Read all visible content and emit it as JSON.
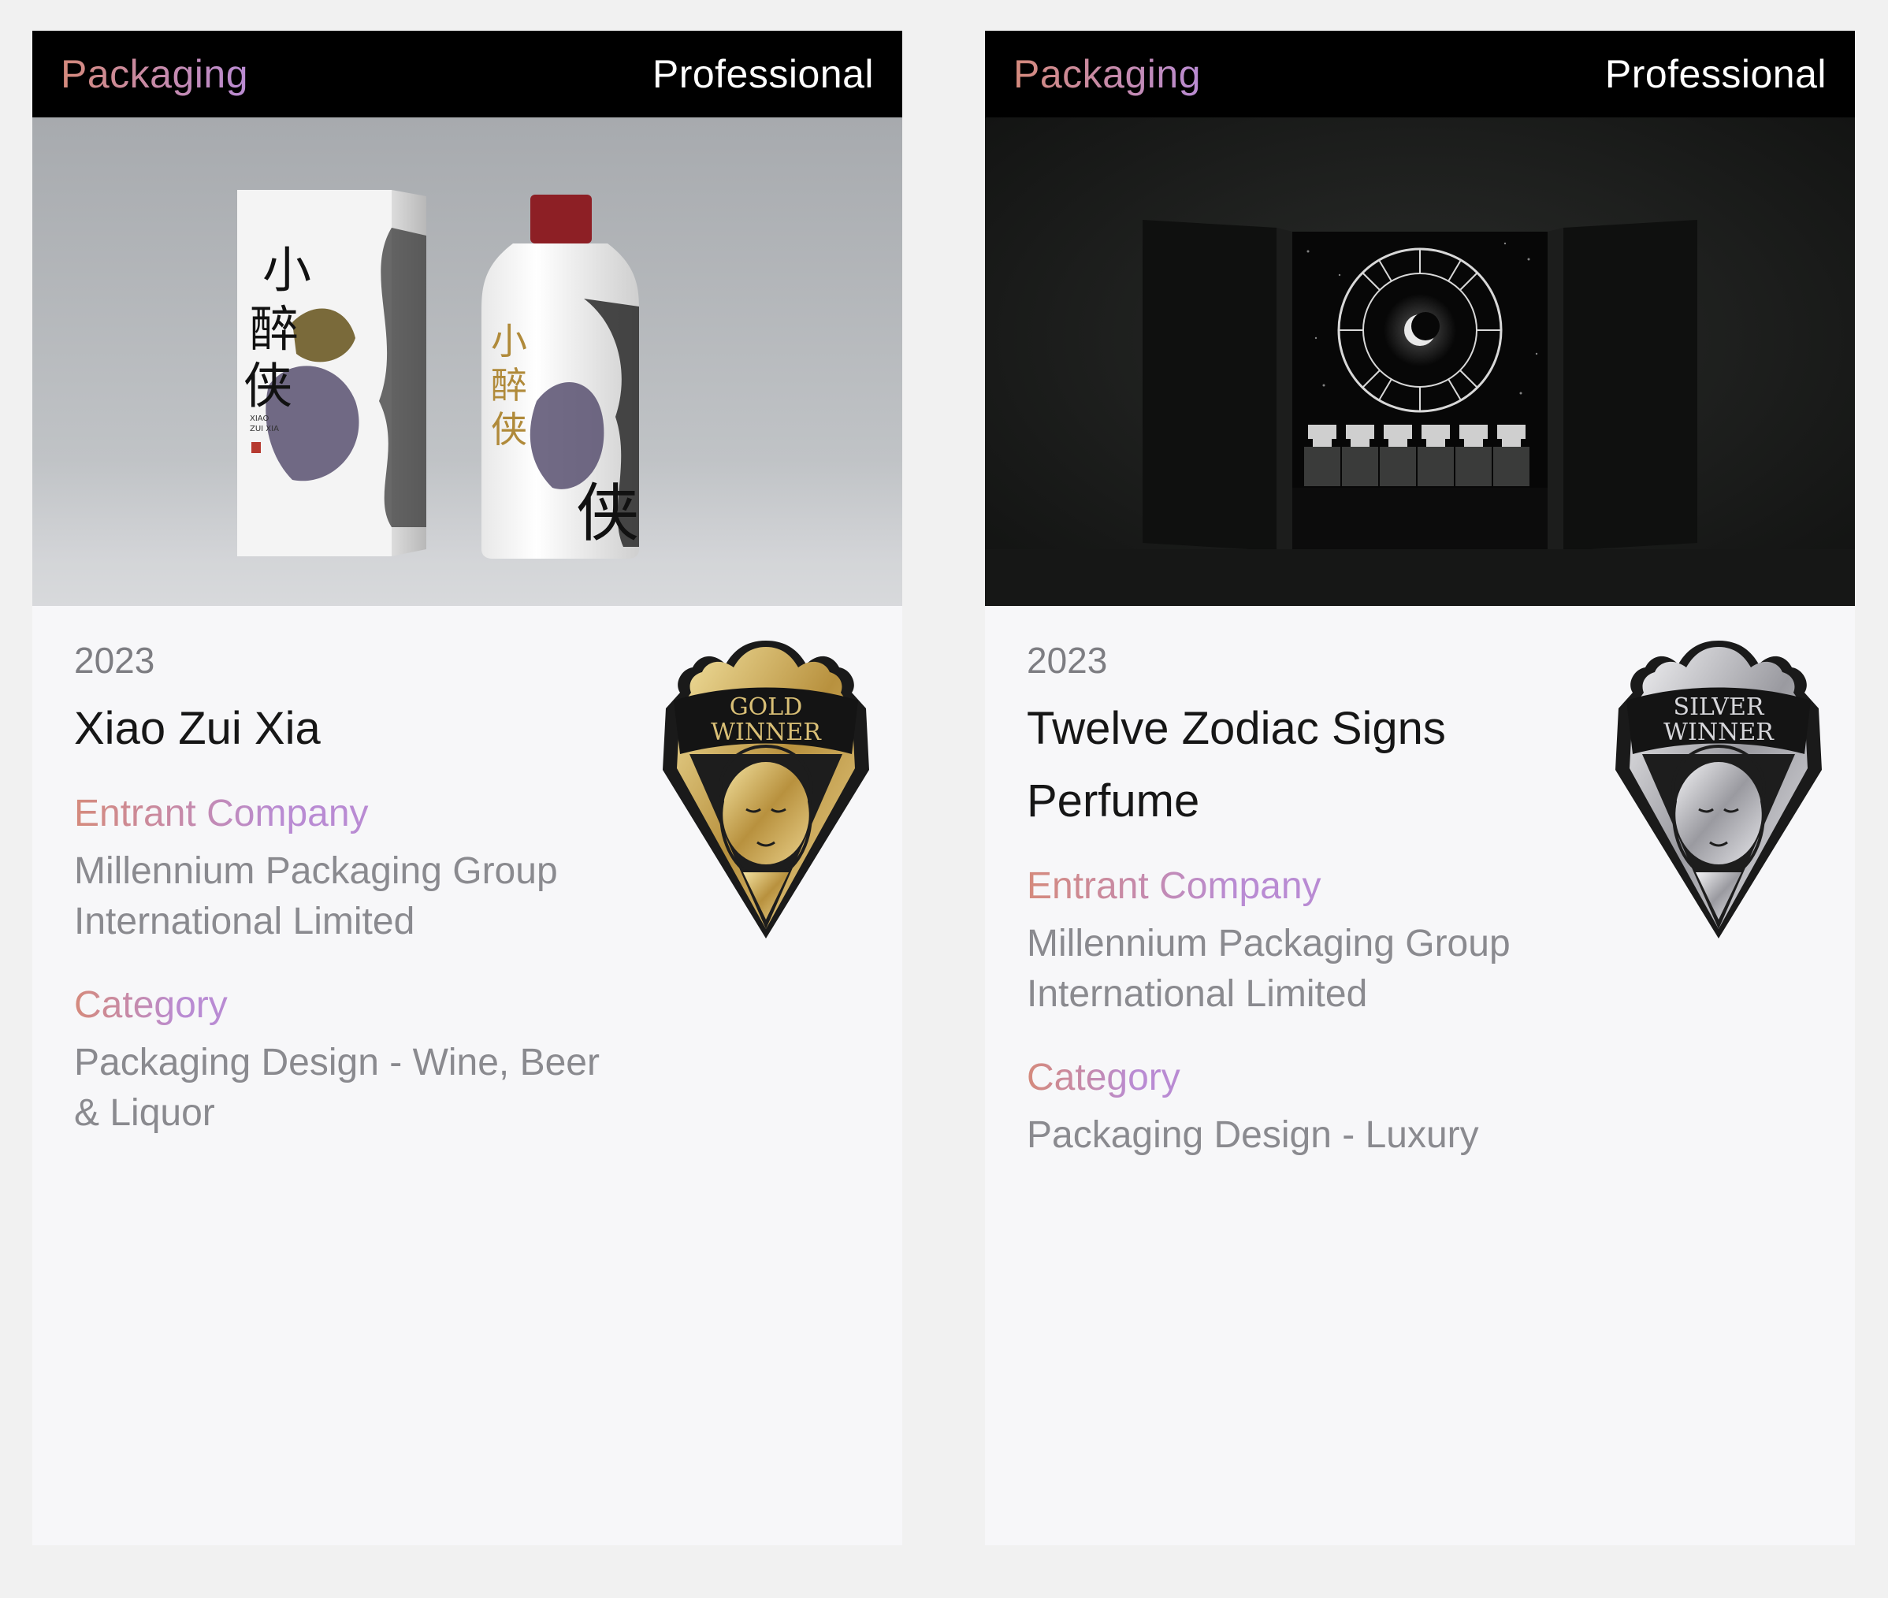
{
  "cards": [
    {
      "type": "Packaging",
      "level": "Professional",
      "image_alt": "Xiao Zui Xia liquor box and bottle",
      "year": "2023",
      "title": "Xiao Zui Xia",
      "entrant_label": "Entrant Company",
      "entrant": "Millennium Packaging Group International Limited",
      "category_label": "Category",
      "category": "Packaging Design - Wine, Beer & Liquor",
      "badge": {
        "line1": "GOLD",
        "line2": "WINNER",
        "color": "#c9a84f"
      },
      "product_text": {
        "box_title": "小醉侠",
        "box_latin_1": "XIAO",
        "box_latin_2": "ZUI XIA"
      }
    },
    {
      "type": "Packaging",
      "level": "Professional",
      "image_alt": "Twelve Zodiac Signs perfume box",
      "year": "2023",
      "title": "Twelve Zodiac Signs Perfume",
      "entrant_label": "Entrant Company",
      "entrant": "Millennium Packaging Group International Limited",
      "category_label": "Category",
      "category": "Packaging Design - Luxury",
      "badge": {
        "line1": "SILVER",
        "line2": "WINNER",
        "color": "#c8c8cc"
      }
    }
  ],
  "colors": {
    "accent_start": "#d58a7c",
    "accent_end": "#b98bd3",
    "header_bg": "#000000",
    "card_bg": "#f7f7f9",
    "page_bg": "#f1f1f1"
  }
}
